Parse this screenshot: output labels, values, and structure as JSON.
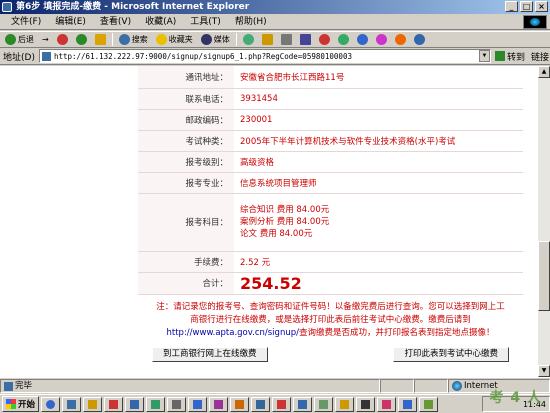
{
  "window": {
    "title": "第6步 填报完成-缴费 - Microsoft Internet Explorer",
    "controls": [
      "_",
      "□",
      "×"
    ]
  },
  "menubar": {
    "items": [
      "文件(F)",
      "编辑(E)",
      "查看(V)",
      "收藏(A)",
      "工具(T)",
      "帮助(H)"
    ]
  },
  "toolbar": {
    "back_label": "后退",
    "forward_label": "→",
    "search_label": "搜索",
    "favorites_label": "收藏夹",
    "media_label": "媒体"
  },
  "address": {
    "label": "地址(D)",
    "url": "http://61.132.222.97:9000/signup/signup6_1.php?RegCode=05980100003",
    "go_label": "转到",
    "links_label": "链接"
  },
  "form": {
    "rows": [
      {
        "label": "通讯地址：",
        "value": "安徽省合肥市长江西路11号"
      },
      {
        "label": "联系电话：",
        "value": "3931454"
      },
      {
        "label": "邮政编码：",
        "value": "230001"
      },
      {
        "label": "考试种类：",
        "value": "2005年下半年计算机技术与软件专业技术资格(水平)考试"
      },
      {
        "label": "报考级别：",
        "value": "高级资格"
      },
      {
        "label": "报考专业：",
        "value": "信息系统项目管理师"
      }
    ],
    "subjects_label": "报考科目：",
    "subjects": [
      "综合知识  费用  84.00元",
      "案例分析  费用  84.00元",
      "论文  费用  84.00元"
    ],
    "fee_label": "手续费：",
    "fee_value": "2.52 元",
    "total_label": "合计：",
    "total_value": "254.52"
  },
  "notice": {
    "line1": "注：请记录您的报考号、查询密码和证件号码！以备缴完费后进行查询。您可以选择到网上工",
    "line2": "商银行进行在线缴费，或是选择打印此表后前往考试中心缴费。缴费后请到",
    "url": "http://www.apta.gov.cn/signup/",
    "line3_suffix": "查询缴费是否成功，并打印报名表到指定地点摄像！"
  },
  "buttons": {
    "online_pay": "到工商银行网上在线缴费",
    "print_pay": "打印此表到考试中心缴费"
  },
  "status": {
    "text": "完毕",
    "zone": "Internet"
  },
  "taskbar": {
    "start_label": "开始",
    "clock": "11:44",
    "watermark": "考 4 人"
  },
  "colors": {
    "title_gradient_start": "#0a246a",
    "value_red": "#cc0000",
    "link_blue": "#0000aa"
  }
}
